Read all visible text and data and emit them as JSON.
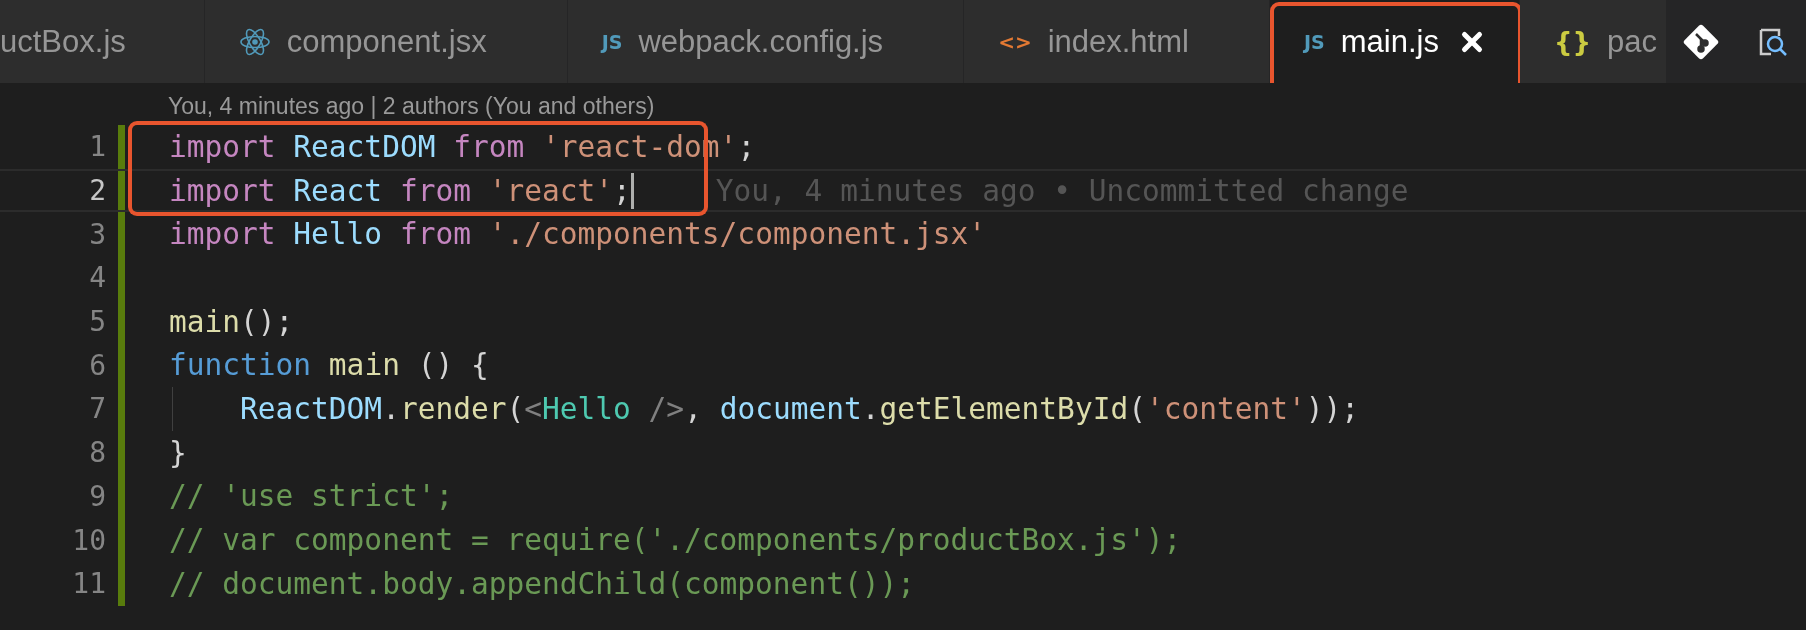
{
  "tabs": [
    {
      "label": "uctBox.js",
      "kind": "none",
      "selected": false,
      "highlighted": false
    },
    {
      "label": "component.jsx",
      "kind": "react",
      "selected": false,
      "highlighted": false
    },
    {
      "label": "webpack.config.js",
      "kind": "js",
      "glyph": "JS",
      "selected": false,
      "highlighted": false
    },
    {
      "label": "index.html",
      "kind": "html",
      "glyph": "<>",
      "selected": false,
      "highlighted": false
    },
    {
      "label": "main.js",
      "kind": "js",
      "glyph": "JS",
      "selected": true,
      "highlighted": true
    },
    {
      "label": "pac",
      "kind": "json",
      "glyph": "{}",
      "selected": false,
      "highlighted": false
    }
  ],
  "codelens": "You, 4 minutes ago | 2 authors (You and others)",
  "lines": [
    {
      "number": "1",
      "highlighted": true,
      "current": false,
      "tokens": [
        {
          "kind": "keyword",
          "text": "import "
        },
        {
          "kind": "variable",
          "text": "ReactDOM "
        },
        {
          "kind": "keyword",
          "text": "from "
        },
        {
          "kind": "string",
          "text": "'react-dom'"
        },
        {
          "kind": "plain",
          "text": ";"
        }
      ]
    },
    {
      "number": "2",
      "highlighted": true,
      "current": true,
      "blame": "You, 4 minutes ago • Uncommitted change",
      "tokens": [
        {
          "kind": "keyword",
          "text": "import "
        },
        {
          "kind": "variable",
          "text": "React "
        },
        {
          "kind": "keyword",
          "text": "from "
        },
        {
          "kind": "string",
          "text": "'react'"
        },
        {
          "kind": "plain",
          "text": ";"
        }
      ]
    },
    {
      "number": "3",
      "highlighted": false,
      "current": false,
      "tokens": [
        {
          "kind": "keyword",
          "text": "import "
        },
        {
          "kind": "variable",
          "text": "Hello "
        },
        {
          "kind": "keyword",
          "text": "from "
        },
        {
          "kind": "string",
          "text": "'./components/component.jsx'"
        }
      ]
    },
    {
      "number": "4",
      "highlighted": false,
      "current": false
    },
    {
      "number": "5",
      "highlighted": false,
      "current": false,
      "tokens": [
        {
          "kind": "function",
          "text": "main"
        },
        {
          "kind": "plain",
          "text": "();"
        }
      ]
    },
    {
      "number": "6",
      "highlighted": false,
      "current": false,
      "tokens": [
        {
          "kind": "storage",
          "text": "function "
        },
        {
          "kind": "function",
          "text": "main"
        },
        {
          "kind": "plain",
          "text": " () {"
        }
      ]
    },
    {
      "number": "7",
      "highlighted": false,
      "current": false,
      "tokens": [
        {
          "kind": "variable",
          "text": "    ReactDOM"
        },
        {
          "kind": "plain",
          "text": "."
        },
        {
          "kind": "function",
          "text": "render"
        },
        {
          "kind": "plain",
          "text": "("
        },
        {
          "kind": "tagpunct",
          "text": "<"
        },
        {
          "kind": "tag",
          "text": "Hello "
        },
        {
          "kind": "tagpunct",
          "text": "/>"
        },
        {
          "kind": "plain",
          "text": ", "
        },
        {
          "kind": "variable",
          "text": "document"
        },
        {
          "kind": "plain",
          "text": "."
        },
        {
          "kind": "function",
          "text": "getElementById"
        },
        {
          "kind": "plain",
          "text": "("
        },
        {
          "kind": "string",
          "text": "'content'"
        },
        {
          "kind": "plain",
          "text": "));"
        }
      ]
    },
    {
      "number": "8",
      "highlighted": false,
      "current": false,
      "tokens": [
        {
          "kind": "plain",
          "text": "}"
        }
      ]
    },
    {
      "number": "9",
      "highlighted": false,
      "current": false,
      "tokens": [
        {
          "kind": "comment",
          "text": "// 'use strict';"
        }
      ]
    },
    {
      "number": "10",
      "highlighted": false,
      "current": false,
      "tokens": [
        {
          "kind": "comment",
          "text": "// var component = require('./components/productBox.js');"
        }
      ]
    },
    {
      "number": "11",
      "highlighted": false,
      "current": false,
      "tokens": [
        {
          "kind": "comment",
          "text": "// document.body.appendChild(component());"
        }
      ]
    }
  ]
}
